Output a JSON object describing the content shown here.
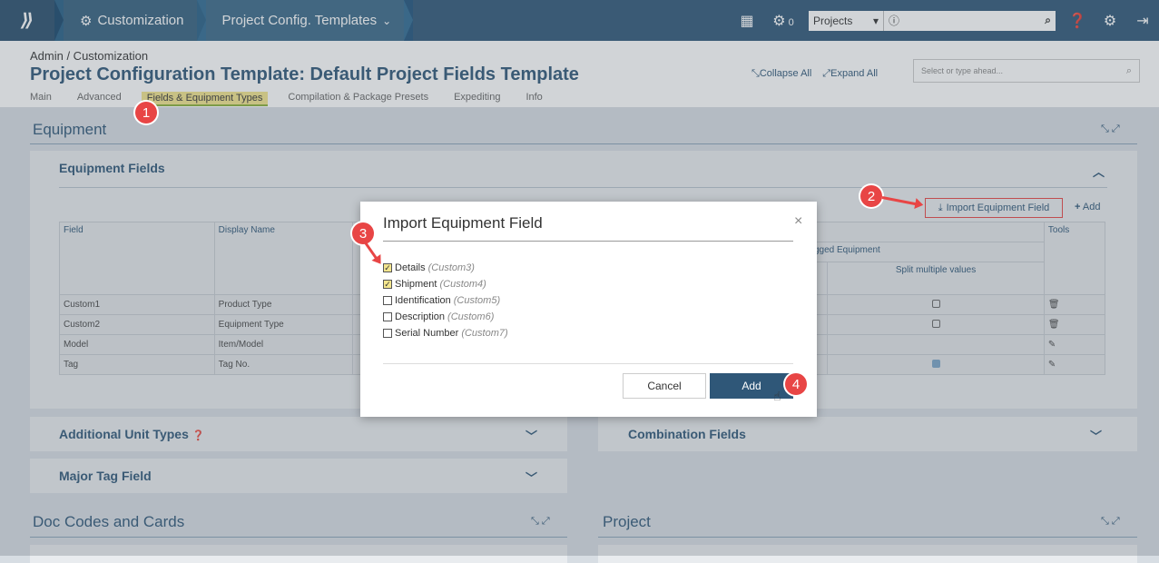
{
  "topbar": {
    "logo": "⟫",
    "crumb1": "Customization",
    "crumb2": "Project Config. Templates",
    "crumb2_caret": "⌄",
    "gear_count": "0",
    "projects_label": "Projects",
    "projects_caret": "▾",
    "info_glyph": "ⓘ"
  },
  "header": {
    "breadcrumb": "Admin / Customization",
    "title": "Project Configuration Template: Default Project Fields Template",
    "tabs": [
      "Main",
      "Advanced",
      "Fields & Equipment Types",
      "Compilation & Package Presets",
      "Expediting",
      "Info"
    ],
    "collapse_all": "Collapse All",
    "expand_all": "Expand All",
    "search_placeholder": "Select or type ahead..."
  },
  "equipment": {
    "section_title": "Equipment",
    "panel_title": "Equipment Fields",
    "import_button": "Import Equipment Field",
    "add_link": "Add",
    "columns": {
      "field": "Field",
      "display_name": "Display Name",
      "tagged_equipment": "gged Equipment",
      "split_multiple": "Split multiple values",
      "tools": "Tools"
    },
    "rows": [
      {
        "field": "Custom1",
        "display": "Product Type",
        "split": "unchecked",
        "tool": "trash"
      },
      {
        "field": "Custom2",
        "display": "Equipment Type",
        "split": "unchecked",
        "tool": "trash"
      },
      {
        "field": "Model",
        "display": "Item/Model",
        "split": "none",
        "tool": "pencil"
      },
      {
        "field": "Tag",
        "display": "Tag No.",
        "split": "checked",
        "tool": "pencil"
      }
    ]
  },
  "panels": {
    "additional_unit_types": "Additional Unit Types",
    "combination_fields": "Combination Fields",
    "major_tag_field": "Major Tag Field"
  },
  "sections": {
    "doc_codes": "Doc Codes and Cards",
    "project": "Project"
  },
  "modal": {
    "title": "Import Equipment Field",
    "close": "×",
    "options": [
      {
        "label": "Details",
        "sub": "(Custom3)",
        "checked": true
      },
      {
        "label": "Shipment",
        "sub": "(Custom4)",
        "checked": true
      },
      {
        "label": "Identification",
        "sub": "(Custom5)",
        "checked": false
      },
      {
        "label": "Description",
        "sub": "(Custom6)",
        "checked": false
      },
      {
        "label": "Serial Number",
        "sub": "(Custom7)",
        "checked": false
      }
    ],
    "cancel": "Cancel",
    "add": "Add"
  },
  "callouts": [
    "1",
    "2",
    "3",
    "4"
  ],
  "colors": {
    "nav": "#2f5778",
    "accent": "#2f5778",
    "callout": "#e84545",
    "highlight": "#f3e58d"
  }
}
